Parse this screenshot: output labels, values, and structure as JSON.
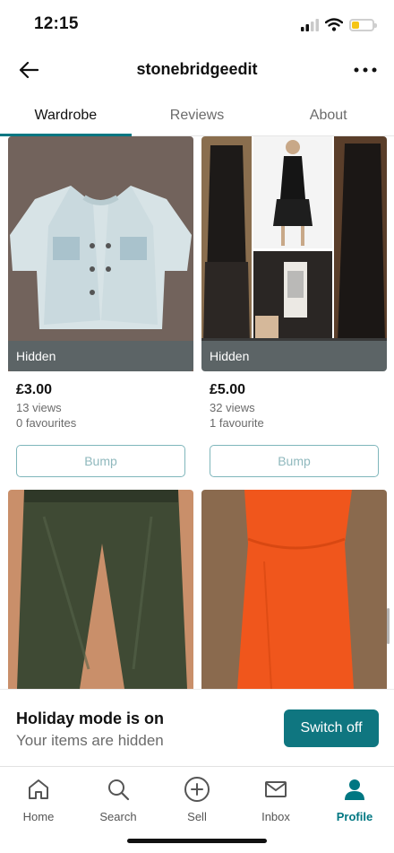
{
  "status_bar": {
    "time": "12:15",
    "battery_level": 0.35,
    "battery_color": "#f5c518"
  },
  "header": {
    "title": "stonebridgeedit",
    "back_icon": "arrow-left-icon",
    "more_icon": "more-horizontal-icon"
  },
  "tabs": [
    {
      "label": "Wardrobe",
      "active": true
    },
    {
      "label": "Reviews",
      "active": false
    },
    {
      "label": "About",
      "active": false
    }
  ],
  "items": [
    {
      "badge": "Hidden",
      "price": "£3.00",
      "views": "13 views",
      "favourites": "0 favourites",
      "bump_label": "Bump",
      "image": "light denim jacket"
    },
    {
      "badge": "Hidden",
      "price": "£5.00",
      "views": "32 views",
      "favourites": "1 favourite",
      "bump_label": "Bump",
      "image": "black dress collage"
    },
    {
      "image": "green trousers"
    },
    {
      "image": "orange dress"
    }
  ],
  "holiday": {
    "title": "Holiday mode is on",
    "subtitle": "Your items are hidden",
    "button_label": "Switch off"
  },
  "nav": [
    {
      "label": "Home",
      "icon": "home-icon",
      "active": false
    },
    {
      "label": "Search",
      "icon": "search-icon",
      "active": false
    },
    {
      "label": "Sell",
      "icon": "plus-circle-icon",
      "active": false
    },
    {
      "label": "Inbox",
      "icon": "mail-icon",
      "active": false
    },
    {
      "label": "Profile",
      "icon": "profile-icon",
      "active": true
    }
  ],
  "colors": {
    "accent": "#007782",
    "switch_button": "#0f7680",
    "hidden_badge": "#5c6466"
  }
}
